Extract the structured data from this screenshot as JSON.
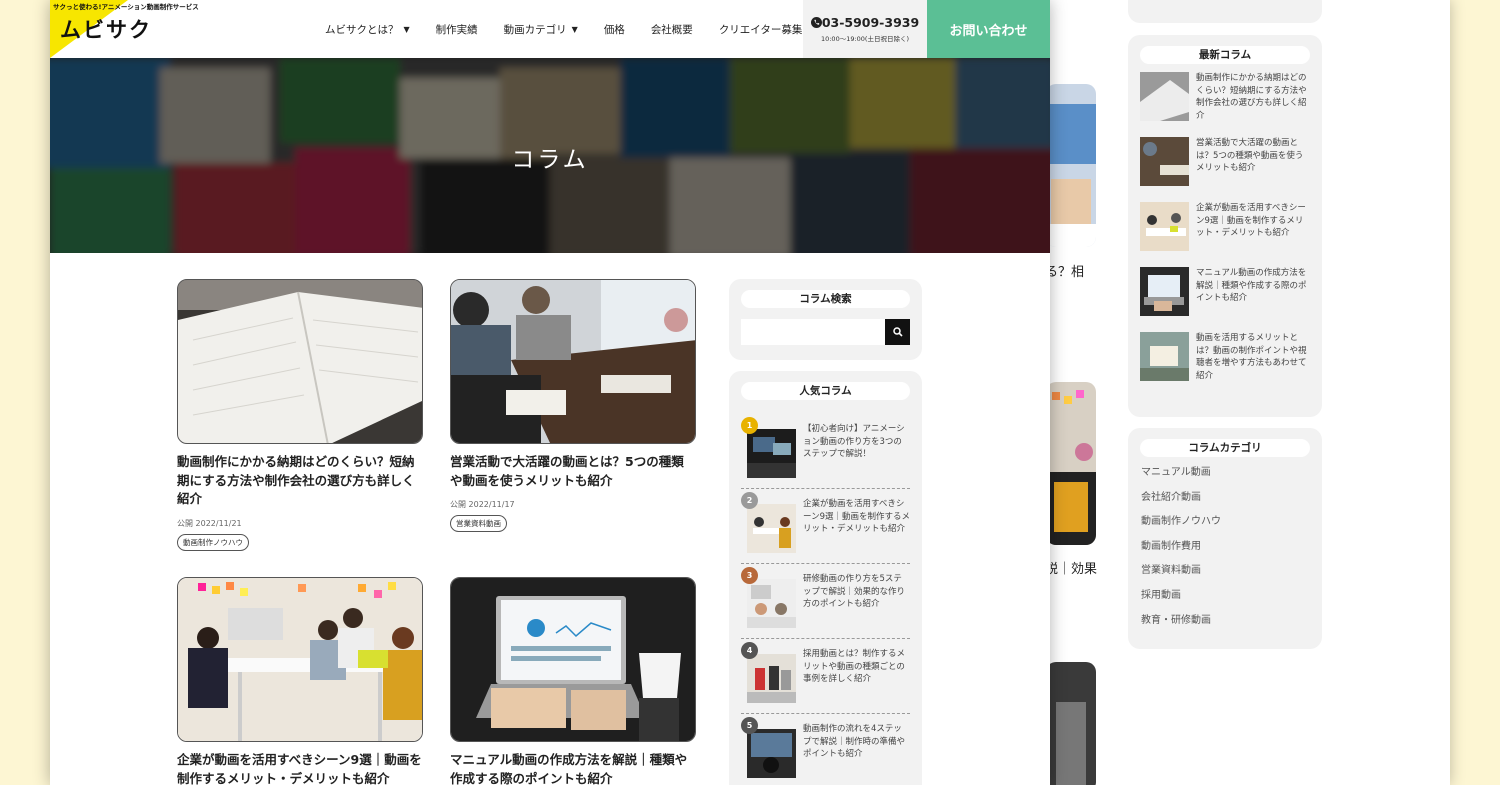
{
  "back": {
    "frag1": "る？相",
    "frag2": "説｜効果",
    "latest_title": "最新コラム",
    "latest": [
      "動画制作にかかる納期はどのくらい？短納期にする方法や制作会社の選び方も詳しく紹介",
      "営業活動で大活躍の動画とは？5つの種類や動画を使うメリットも紹介",
      "企業が動画を活用すべきシーン9選｜動画を制作するメリット・デメリットも紹介",
      "マニュアル動画の作成方法を解説｜種類や作成する際のポイントも紹介",
      "動画を活用するメリットとは？動画の制作ポイントや視聴者を増やす方法もあわせて紹介"
    ],
    "cat_title": "コラムカテゴリ",
    "categories": [
      "マニュアル動画",
      "会社紹介動画",
      "動画制作ノウハウ",
      "動画制作費用",
      "営業資料動画",
      "採用動画",
      "教育・研修動画"
    ]
  },
  "header": {
    "tagline": "サクっと使わる!アニメーション動画制作サービス",
    "logo": "ムビサク",
    "nav": [
      {
        "label": "ムビサクとは？",
        "caret": true
      },
      {
        "label": "制作実績",
        "caret": false
      },
      {
        "label": "動画カテゴリ",
        "caret": true
      },
      {
        "label": "価格",
        "caret": false
      },
      {
        "label": "会社概要",
        "caret": false
      },
      {
        "label": "クリエイター募集",
        "caret": false
      }
    ],
    "caret_glyph": "▼",
    "phone": "03-5909-3939",
    "hours": "10:00〜19:00(土日祝日除く)",
    "contact": "お問い合わせ"
  },
  "hero": {
    "title": "コラム"
  },
  "cards": [
    {
      "title": "動画制作にかかる納期はどのくらい？短納期にする方法や制作会社の選び方も詳しく紹介",
      "date": "公開 2022/11/21",
      "tag": "動画制作ノウハウ"
    },
    {
      "title": "営業活動で大活躍の動画とは？5つの種類や動画を使うメリットも紹介",
      "date": "公開 2022/11/17",
      "tag": "営業資料動画"
    },
    {
      "title": "企業が動画を活用すべきシーン9選｜動画を制作するメリット・デメリットも紹介",
      "date": "",
      "tag": ""
    },
    {
      "title": "マニュアル動画の作成方法を解説｜種類や作成する際のポイントも紹介",
      "date": "",
      "tag": ""
    }
  ],
  "sidebar": {
    "search_title": "コラム検索",
    "search_placeholder": "",
    "popular_title": "人気コラム",
    "popular": [
      {
        "rank": "1",
        "text": "【初心者向け】アニメーション動画の作り方を3つのステップで解説！",
        "color": "#e8b200"
      },
      {
        "rank": "2",
        "text": "企業が動画を活用すべきシーン9選｜動画を制作するメリット・デメリットも紹介",
        "color": "#9a9a9a"
      },
      {
        "rank": "3",
        "text": "研修動画の作り方を5ステップで解説｜効果的な作り方のポイントも紹介",
        "color": "#b8693a"
      },
      {
        "rank": "4",
        "text": "採用動画とは？制作するメリットや動画の種類ごとの事例を詳しく紹介",
        "color": "#555555"
      },
      {
        "rank": "5",
        "text": "動画制作の流れを4ステップで解説｜制作時の準備やポイントも紹介",
        "color": "#555555"
      }
    ]
  },
  "colors": {
    "accent": "#5bbf95",
    "logo_yellow": "#f7e600"
  }
}
